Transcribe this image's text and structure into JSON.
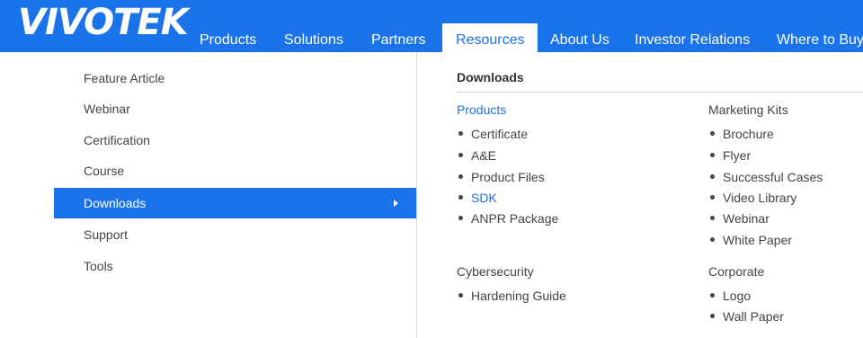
{
  "header": {
    "logo_text": "VIVOTEK",
    "brand_color": "#1a73e8",
    "nav": [
      "Products",
      "Solutions",
      "Partners",
      "Resources",
      "About Us",
      "Investor Relations",
      "Where to Buy"
    ],
    "active_nav": "Resources"
  },
  "left_menu": {
    "items": [
      "Feature Article",
      "Webinar",
      "Certification",
      "Course",
      "Downloads",
      "Support",
      "Tools"
    ],
    "active_item": "Downloads",
    "active_arrow_icon": "chevron-right-icon"
  },
  "downloads": {
    "title": "Downloads",
    "products": {
      "heading": "Products",
      "items": [
        "Certificate",
        "A&E",
        "Product Files",
        "SDK",
        "ANPR Package"
      ]
    },
    "marketing_kits": {
      "heading": "Marketing Kits",
      "items": [
        "Brochure",
        "Flyer",
        "Successful Cases",
        "Video Library",
        "Webinar",
        "White Paper"
      ]
    },
    "cybersecurity": {
      "heading": "Cybersecurity",
      "items": [
        "Hardening Guide"
      ]
    },
    "corporate": {
      "heading": "Corporate",
      "items": [
        "Logo",
        "Wall Paper"
      ]
    }
  }
}
